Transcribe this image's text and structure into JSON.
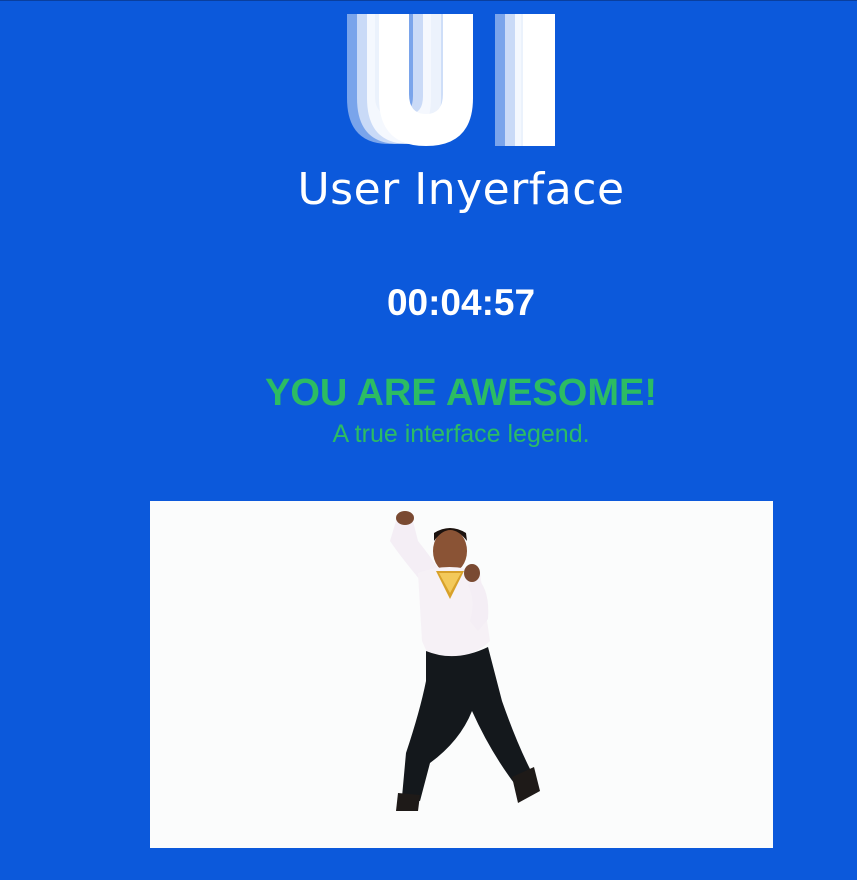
{
  "header": {
    "logo_letters": "UI",
    "app_name": "User Inyerface"
  },
  "timer": {
    "value": "00:04:57"
  },
  "result": {
    "headline": "YOU ARE AWESOME!",
    "subline": "A true interface legend."
  },
  "media": {
    "subject": "dancing-man-animation"
  },
  "colors": {
    "background": "#0c59db",
    "success_text": "#2cbc63",
    "primary_text": "#ffffff",
    "media_background": "#fbfcfc"
  }
}
